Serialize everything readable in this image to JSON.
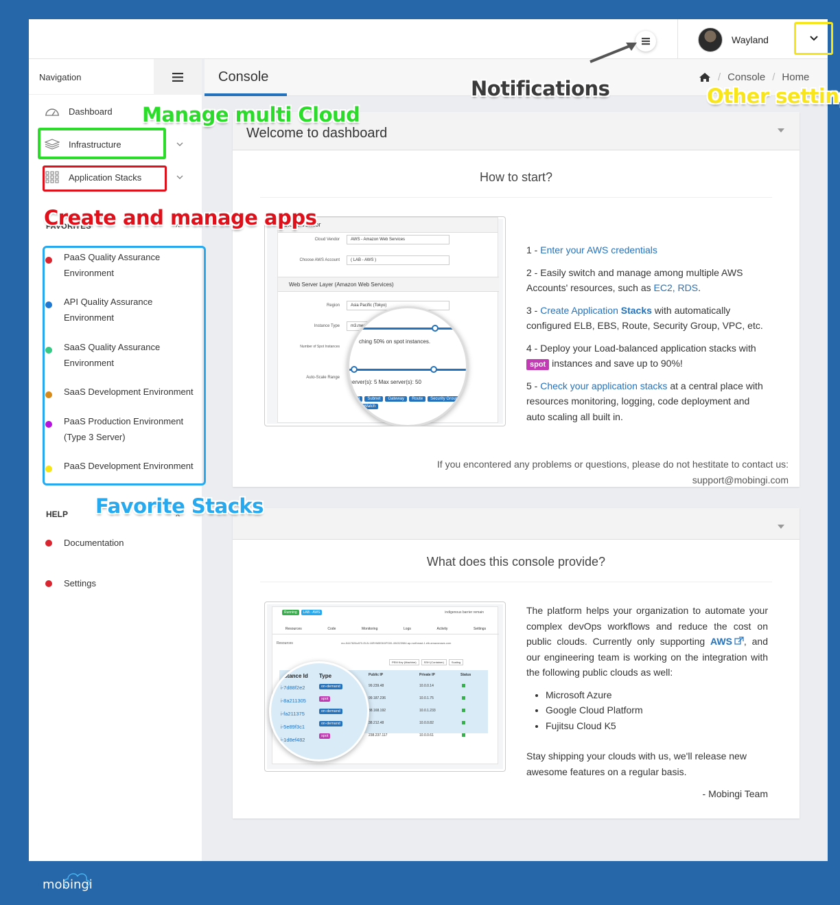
{
  "topbar": {
    "username": "Wayland"
  },
  "sidebar": {
    "title": "Navigation",
    "items": [
      {
        "label": "Dashboard"
      },
      {
        "label": "Infrastructure"
      },
      {
        "label": "Application Stacks"
      }
    ],
    "favorites_title": "FAVORITES",
    "favorites": [
      {
        "label": "PaaS Quality Assurance Environment",
        "color": "#d9252f"
      },
      {
        "label": "API Quality Assurance Environment",
        "color": "#1f78d1"
      },
      {
        "label": "SaaS Quality Assurance Environment",
        "color": "#35c985"
      },
      {
        "label": "SaaS Development Environment",
        "color": "#d68a1a"
      },
      {
        "label": "PaaS Production Environment (Type 3 Server)",
        "color": "#b514e0"
      },
      {
        "label": "PaaS Development Environment",
        "color": "#f5e416"
      }
    ],
    "help_title": "HELP",
    "help_items": [
      {
        "label": "Documentation",
        "color": "#d9252f"
      },
      {
        "label": "Settings",
        "color": "#d9252f"
      }
    ]
  },
  "console": {
    "title": "Console",
    "breadcrumb": [
      "Console",
      "Home"
    ]
  },
  "panel1": {
    "title": "Welcome to dashboard",
    "heading": "How to start?",
    "steps": {
      "s1_prefix": "1 - ",
      "s1_link": "Enter your AWS credentials",
      "s2_text": "2 - Easily switch and manage among multiple AWS Accounts' resources, such as ",
      "s2_link": "EC2, RDS",
      "s2_end": ".",
      "s3_prefix": "3 - ",
      "s3_link": "Create Application ",
      "s3_bold": "Stacks",
      "s3_text": " with automatically configured ELB, EBS, Route, Security Group, VPC, etc.",
      "s4_text": "4 - Deploy your Load-balanced application stacks with",
      "s4_badge": "spot",
      "s4_end": " instances and save up to 90%!",
      "s5_prefix": "5 - ",
      "s5_link": "Check your application stacks",
      "s5_text": " at a central place with resources monitoring, logging, code deployment and auto scaling all built in."
    },
    "contact_line": "If you encontered any problems or questions, please do not hestitate to contact us:",
    "contact_email": "support@mobingi.com",
    "screenshot": {
      "header": "Cloud Vendor",
      "vendor_label": "Cloud Vendor",
      "vendor_value": "AWS - Amazon Web Services",
      "account_label": "Choose AWS Account",
      "account_value": "( LAB - AWS )",
      "layer_title": "Web Server Layer (Amazon Web Services)",
      "region_label": "Region",
      "region_value": "Asia Pacific (Tokyo)",
      "instance_label": "Instance Type",
      "instance_value": "m3.med",
      "spot_label": "Number of Spot Instances",
      "spot_text": "ching 50% on spot instances.",
      "autoscale_label": "Auto-Scale Range",
      "autoscale_text": "server(s): 5  Max server(s): 50",
      "tags": [
        "ELB",
        "Subnet",
        "Gateway",
        "Route",
        "Security Group",
        "Cloud Watch"
      ]
    }
  },
  "panel2": {
    "heading": "What does this console provide?",
    "intro_before": "The platform helps your organization to automate your complex devOps workflows and reduce the cost on public clouds. Currently only supporting ",
    "intro_link": "AWS",
    "intro_after": ", and our engineering team is working on the integration with the following public clouds as well:",
    "clouds": [
      "Microsoft Azure",
      "Google Cloud Platform",
      "Fujitsu Cloud K5"
    ],
    "outro": "Stay shipping your clouds with us, we'll release new awesome features on a regular basis.",
    "signature": "- Mobingi Team",
    "screenshot": {
      "badge_running": "Running",
      "badge_lab": "LAB - AWS",
      "remain": "indigenous barrier remain",
      "tabs": [
        "Resources",
        "Code",
        "Monitoring",
        "Logs",
        "Activity",
        "Settings"
      ],
      "resources_label": "Resources",
      "resources_value": "mo-5447826c870-ELB-16RHM5SK6FS00-494323984.ap-northeast-1.elb.amazonaws.com",
      "buttons": [
        "PEM Key (Machine)",
        "SSH (Container)",
        "Scaling"
      ],
      "columns": [
        "Instance Id",
        "Type",
        "Public IP",
        "Private IP",
        "Status"
      ],
      "rows": [
        {
          "id": "i-7d88f2e2",
          "type": "on-demand",
          "public": "99.239.48",
          "private": "10.0.0.14"
        },
        {
          "id": "i-8a211305",
          "type": "spot",
          "public": "99.187.236",
          "private": "10.0.1.75"
        },
        {
          "id": "i-fa211375",
          "type": "on-demand",
          "public": "38.168.192",
          "private": "10.0.1.233"
        },
        {
          "id": "i-5e89f3c1",
          "type": "on-demand",
          "public": "38.212.48",
          "private": "10.0.0.82"
        },
        {
          "id": "i-1d8ef482",
          "type": "spot",
          "public": "238.237.117",
          "private": "10.0.0.61"
        }
      ]
    }
  },
  "annotations": {
    "notifications": "Notifications",
    "other_settings": "Other settings",
    "manage_cloud": "Manage multi Cloud",
    "create_apps": "Create and manage apps",
    "favorite_stacks": "Favorite Stacks"
  },
  "footer": {
    "logo": "mobingi"
  }
}
